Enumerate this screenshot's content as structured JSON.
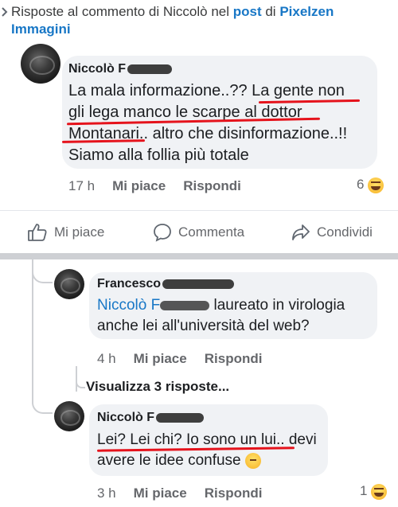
{
  "header": {
    "prefix": "Risposte al commento di Niccolò nel ",
    "post_link": "post",
    "middle": " di ",
    "page_name_line1": "Pixelzen",
    "page_name_line2": "Immagini"
  },
  "comment1": {
    "author": "Niccolò F",
    "lines": [
      "La mala informazione..?? La gente non",
      "gli lega manco le scarpe al dottor",
      "Montanari.. altro che disinformazione..!!",
      "Siamo alla follia più totale"
    ],
    "time": "17 h",
    "like": "Mi piace",
    "reply": "Rispondi",
    "reaction_count": "6",
    "reaction_icon": "haha-emoji"
  },
  "actions": {
    "like": "Mi piace",
    "comment": "Commenta",
    "share": "Condividi"
  },
  "reply1": {
    "author": "Francesco",
    "mention": "Niccolò F",
    "lines": [
      " laureato in virologia",
      "anche lei all'università del web?"
    ],
    "time": "4 h",
    "like": "Mi piace",
    "reply": "Rispondi"
  },
  "view_more": "Visualizza 3 risposte...",
  "reply2": {
    "author": "Niccolò F",
    "line1": "Lei? Lei chi? Io sono un lui.. devi",
    "line2": "avere le idee confuse",
    "time": "3 h",
    "like": "Mi piace",
    "reply": "Rispondi",
    "reaction_count": "1",
    "reaction_icon": "haha-emoji"
  },
  "colors": {
    "link": "#1877c6",
    "bubble": "#f0f2f5",
    "meta": "#65676b",
    "underline": "#e5131c"
  }
}
